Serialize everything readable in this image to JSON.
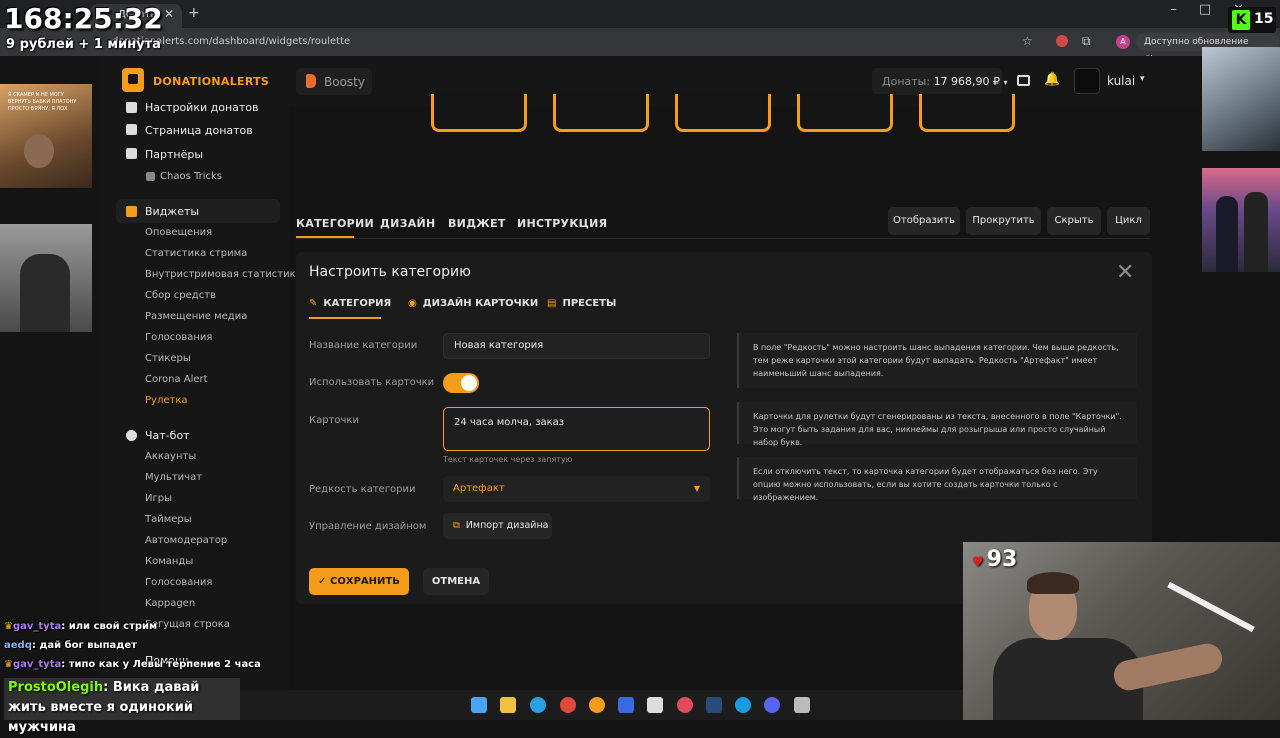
{
  "browser": {
    "tab_title": "Донаты — Donation",
    "url": "donationalerts.com/dashboard/widgets/roulette",
    "update_label": "Доступно обновление Chrome",
    "profile_letter": "A"
  },
  "header": {
    "logo": "DONATIONALERTS",
    "boosty": "Boosty",
    "balance_label": "Донаты:",
    "balance_value": "17 968,90 ₽",
    "username": "kulai"
  },
  "sidebar": {
    "donate_settings": "Настройки донатов",
    "donate_page": "Страница донатов",
    "partners": "Партнёры",
    "chaos_tricks": "Chaos Tricks",
    "widgets": "Виджеты",
    "widget_items": [
      "Оповещения",
      "Статистика стрима",
      "Внутристримовая статистика",
      "Сбор средств",
      "Размещение медиа",
      "Голосования",
      "Стикеры",
      "Corona Alert",
      "Рулетка"
    ],
    "chatbot": "Чат-бот",
    "chatbot_items": [
      "Аккаунты",
      "Мультичат",
      "Игры",
      "Таймеры",
      "Автомодератор",
      "Команды",
      "Голосования",
      "Kappagen",
      "Бегущая строка"
    ],
    "help": "Помощь"
  },
  "main_tabs": [
    "КАТЕГОРИИ",
    "ДИЗАЙН",
    "ВИДЖЕТ",
    "ИНСТРУКЦИЯ"
  ],
  "actions": [
    "Отобразить",
    "Прокрутить",
    "Скрыть",
    "Цикл"
  ],
  "panel": {
    "title": "Настроить категорию",
    "tabs": [
      "КАТЕГОРИЯ",
      "ДИЗАЙН КАРТОЧКИ",
      "ПРЕСЕТЫ"
    ],
    "fields": {
      "name_label": "Название категории",
      "name_value": "Новая категория",
      "use_cards_label": "Использовать карточки",
      "use_cards_on": true,
      "cards_label": "Карточки",
      "cards_value": "24 часа молча, заказ",
      "cards_hint": "Текст карточек через запятую",
      "rarity_label": "Редкость категории",
      "rarity_value": "Артефакт",
      "design_label": "Управление дизайном",
      "import_label": "Импорт дизайна"
    },
    "info": [
      "В поле \"Редкость\" можно настроить шанс выпадения категории. Чем выше редкость, тем реже карточки этой категории будут выпадать. Редкость \"Артефакт\" имеет наименьший шанс выпадения.",
      "Карточки для рулетки будут сгенерированы из текста, внесенного в поле \"Карточки\". Это могут быть задания для вас, никнеймы для розыгрыша или просто случайный набор букв.",
      "Если отключить текст, то карточка категории будет отображаться без него. Эту опцию можно использовать, если вы хотите создать карточки только с изображением."
    ],
    "save": "СОХРАНИТЬ",
    "cancel": "ОТМЕНА"
  },
  "overlay": {
    "timer": "168:25:32",
    "rate": "9 рублей + 1 минута",
    "kick_count": "15",
    "hearts": "93",
    "cam_caption": "Я СКАМЕР И НЕ МОГУ ВЕРНУТЬ БАБКИ ПЛАТОНУ ПРОСТО ВЯЙНУ, Я ЛОХ",
    "chat": [
      {
        "user": "gav_tyta",
        "text": "или свой стрим",
        "crown": true
      },
      {
        "user": "aedq",
        "text": "дай бог выпадет",
        "crown": false
      },
      {
        "user": "gav_tyta",
        "text": "типо как у Левы терпение 2 часа",
        "crown": true
      }
    ],
    "highlight_user": "ProstoOlegih",
    "highlight_text": "Вика давай жить вместе я одинокий мужчина"
  },
  "colors": {
    "accent": "#f59c1a",
    "bg": "#141414",
    "panel": "#1b1b1b"
  }
}
